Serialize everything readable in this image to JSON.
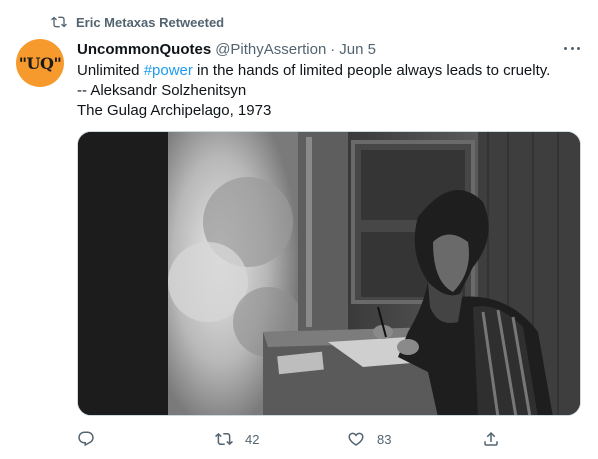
{
  "retweet": {
    "icon": "retweet-icon",
    "text": "Eric Metaxas Retweeted"
  },
  "tweet": {
    "avatar_text": "\"UQ\"",
    "author_name": "UncommonQuotes",
    "author_handle": "@PithyAssertion",
    "separator": "·",
    "date": "Jun 5",
    "more_icon": "more-icon",
    "text": {
      "line1_before": "Unlimited ",
      "hashtag": "#power",
      "line1_after": " in the hands of limited people always leads to cruelty.",
      "line2": "-- Aleksandr Solzhenitsyn",
      "line3": "The Gulag Archipelago, 1973"
    },
    "media": {
      "icon": "photo-icon"
    },
    "actions": {
      "reply": {
        "icon": "reply-icon",
        "count": ""
      },
      "retweet": {
        "icon": "retweet-icon",
        "count": "42"
      },
      "like": {
        "icon": "like-icon",
        "count": "83"
      },
      "share": {
        "icon": "share-icon",
        "count": ""
      }
    }
  },
  "colors": {
    "secondary_text": "#536471",
    "hashtag": "#1d9bf0",
    "avatar_bg": "#f79a2e"
  }
}
